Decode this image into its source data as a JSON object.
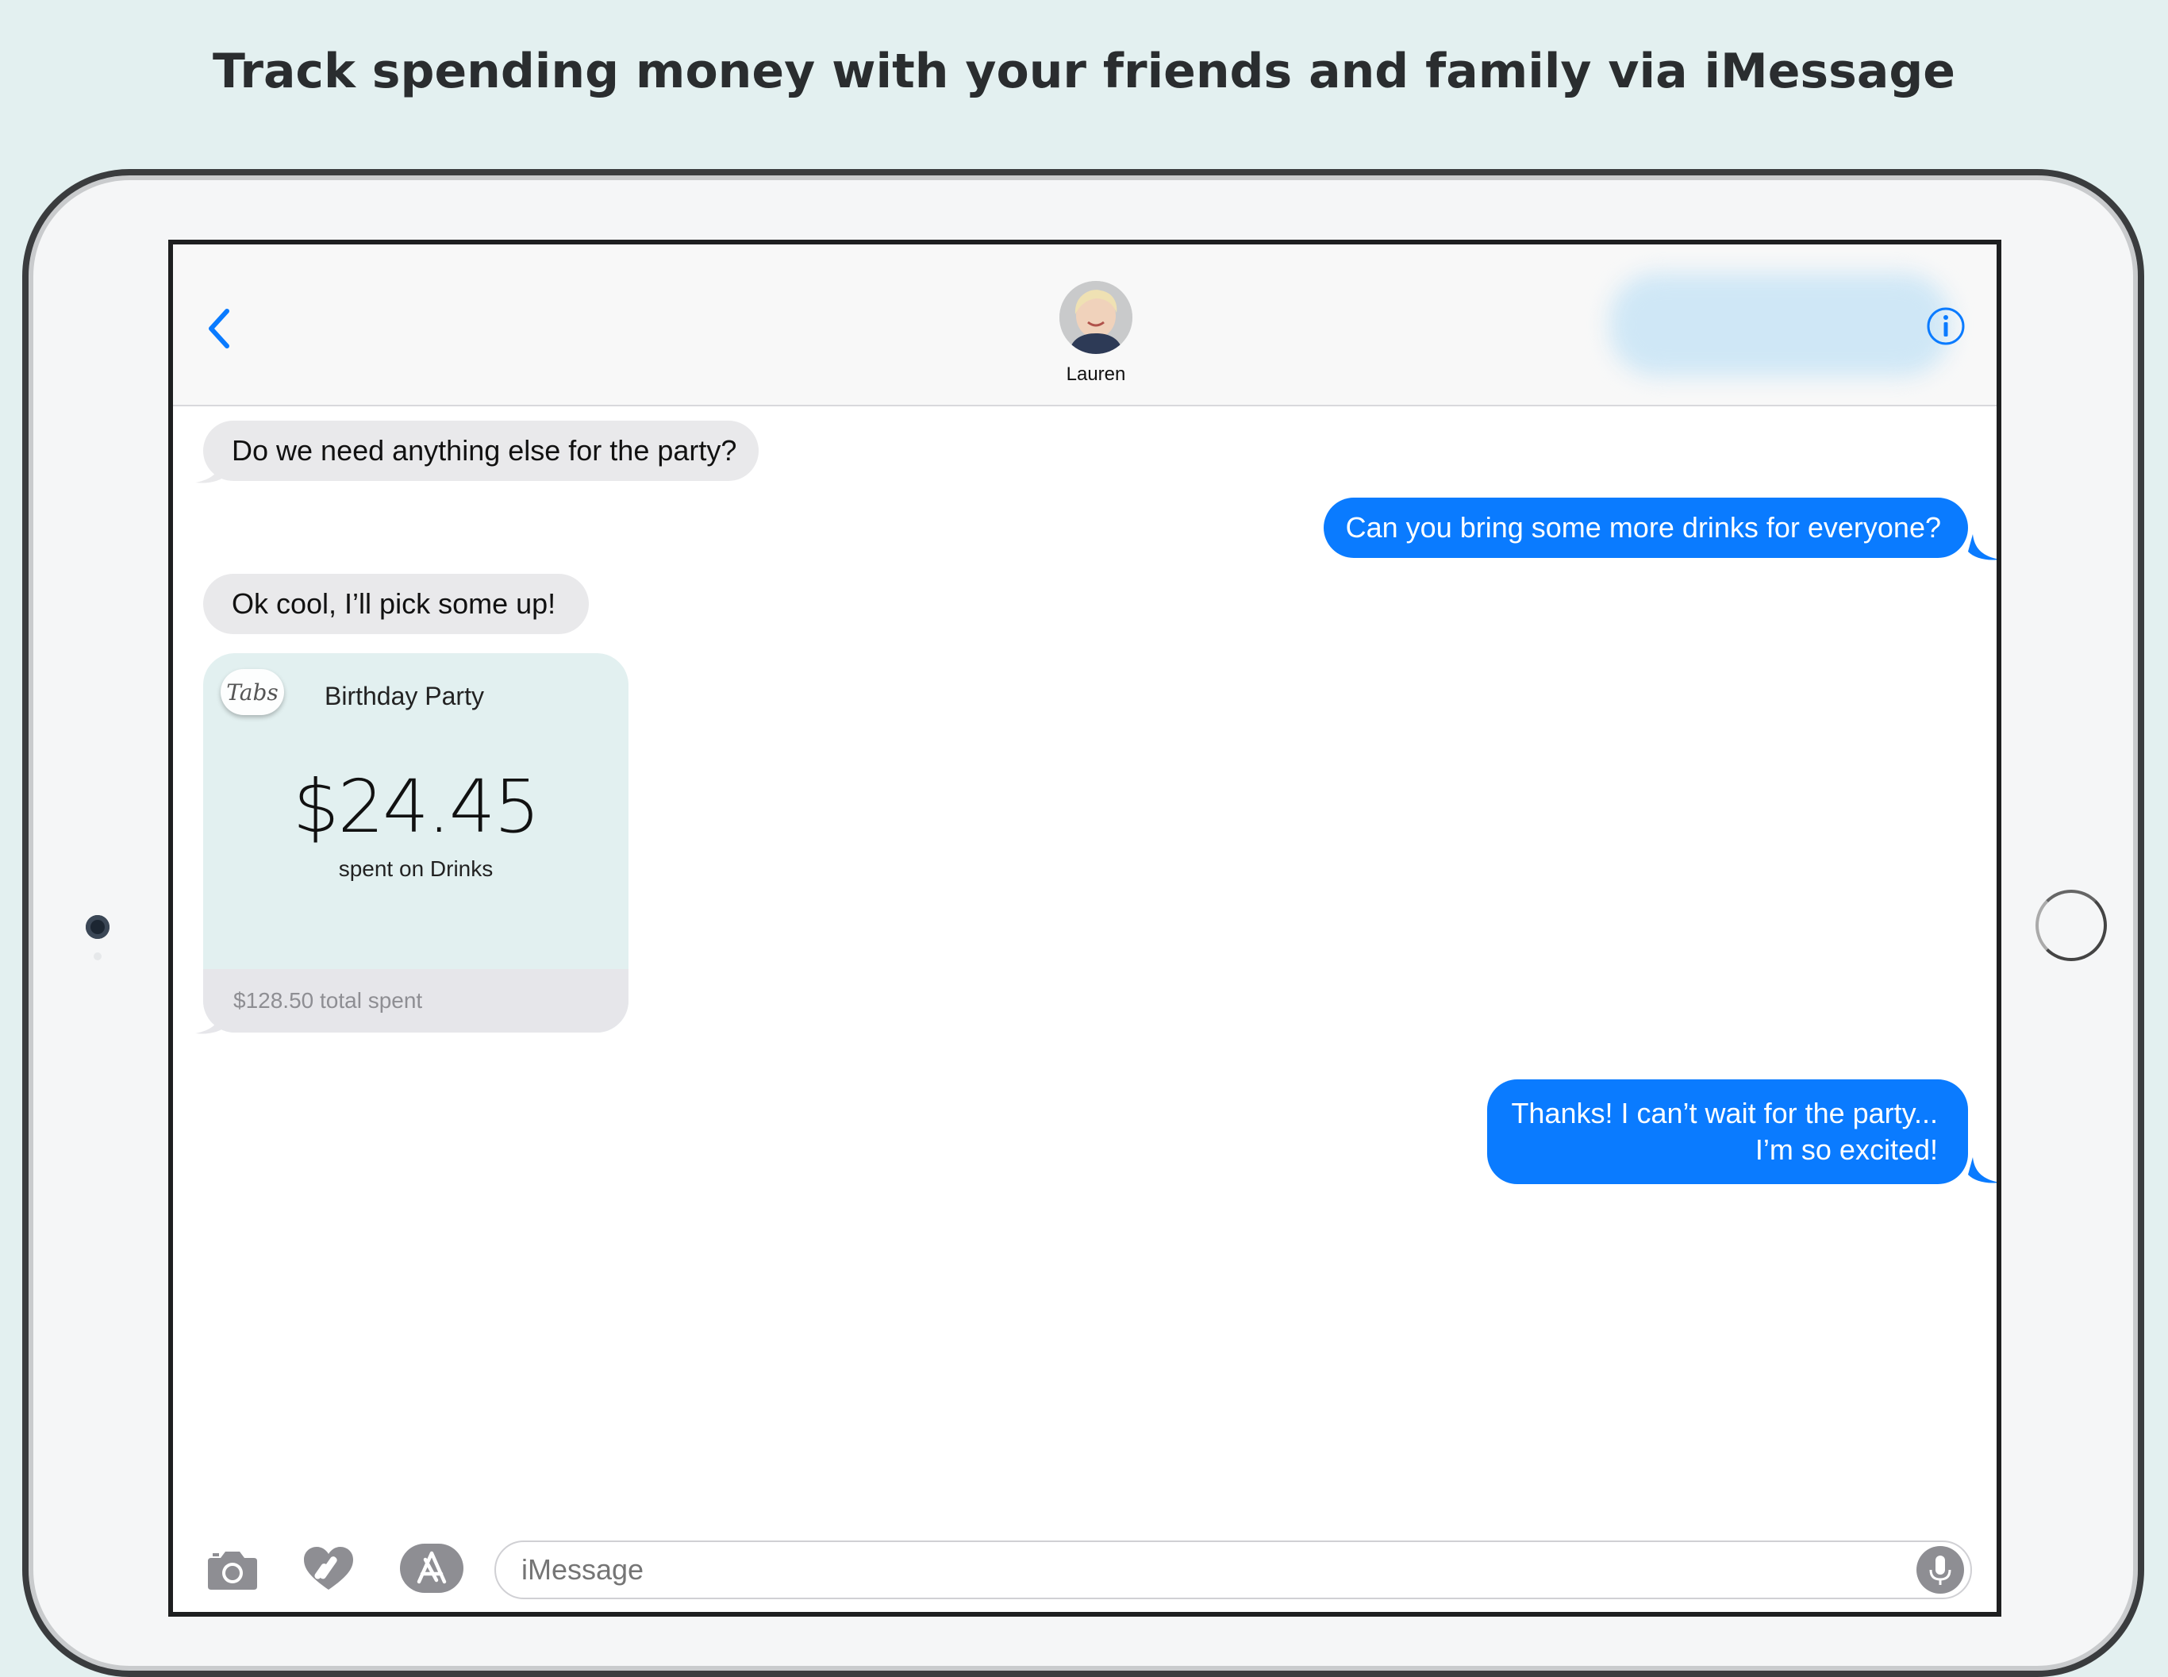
{
  "headline": "Track spending money with your friends and family via iMessage",
  "header": {
    "contact_name": "Lauren"
  },
  "messages": [
    {
      "direction": "incoming",
      "text": "Do we need anything else for the party?"
    },
    {
      "direction": "outgoing",
      "text": "Can you bring some more drinks for everyone?"
    },
    {
      "direction": "incoming",
      "text": "Ok cool, I’ll pick some up!"
    },
    {
      "direction": "outgoing",
      "line1": "Thanks! I can’t wait for the party...",
      "line2": "I’m so excited!"
    }
  ],
  "tabs_card": {
    "logo_text": "Tabs",
    "title": "Birthday Party",
    "amount": "$24.45",
    "subtitle": "spent on Drinks",
    "total": "$128.50 total spent"
  },
  "composer": {
    "placeholder": "iMessage"
  },
  "colors": {
    "outgoing_bubble": "#0a7bff",
    "incoming_bubble": "#e9e9eb",
    "accent": "#0a7bff",
    "page_background": "#e3f0f0"
  }
}
